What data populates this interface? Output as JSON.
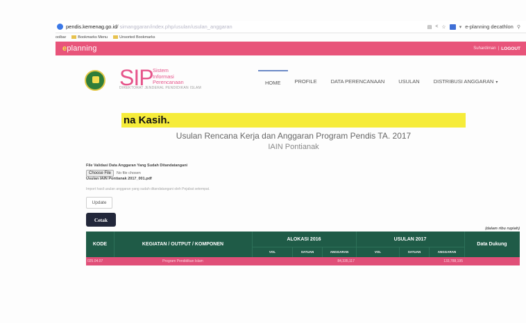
{
  "browser": {
    "url_host": "pendis.kemenag.go.id/",
    "url_path": "simanggaran/index.php/usulan/usulan_anggaran",
    "search_text": "e-planning decathlon",
    "bookmarks": [
      "Bookmarks Menu",
      "Unsorted Bookmarks"
    ],
    "bookmarks_prefix": "oolbar"
  },
  "appbar": {
    "brand_initial": "e",
    "brand_rest": "planning",
    "user": "Suhardiman",
    "logout": "LOGOUT",
    "color": "#e8547a"
  },
  "site": {
    "logo_text": "SIP",
    "subtitle_lines": [
      "Sistem",
      "Informasi",
      "Perencanaan"
    ],
    "directorate": "DIREKTORAT JENDERAL PENDIDIKAN ISLAM"
  },
  "nav": {
    "items": [
      "HOME",
      "PROFILE",
      "DATA PERENCANAAN",
      "USULAN",
      "DISTRIBUSI ANGGARAN"
    ],
    "active": "HOME",
    "dropdown_caret": "▾"
  },
  "main": {
    "banner": "na Kasih.",
    "title": "Usulan Rencana Kerja dan Anggaran Program Pendis TA. 2017",
    "institution": "IAIN Pontianak",
    "file_label": "File Validasi Data Anggaran Yang Sudah Ditandatangani",
    "choose_file_label": "Choose File",
    "no_file_label": "No file chosen",
    "usulan_file": "Usulan IAIN Pontianak 2017_001.pdf",
    "help_text": "Import hasil usulan anggaran yang sudah ditandatangani oleh Pejabat setempat.",
    "update_label": "Update",
    "cetak_label": "Cetak",
    "satuan_note": "(dalam ribu rupiah)"
  },
  "table": {
    "header_color": "#1f5b47",
    "headers": {
      "kode": "KODE",
      "kegiatan": "KEGIATAN / OUTPUT / KOMPONEN",
      "alokasi": "ALOKASI 2016",
      "usulan": "USULAN 2017",
      "data_dukung": "Data Dukung"
    },
    "sub_headers": [
      "VOL",
      "SATUAN",
      "ANGGARAN",
      "VOL",
      "SATUAN",
      "ANGGARAN"
    ],
    "rows": [
      {
        "kode": "025.04.07",
        "kegiatan": "Program Pendidikan Islam",
        "alokasi_vol": "",
        "alokasi_satuan": "",
        "alokasi_anggaran": "84,335,117",
        "usulan_vol": "",
        "usulan_satuan": "",
        "usulan_anggaran": "133,788,195",
        "row_color": "#e04f78"
      }
    ]
  }
}
